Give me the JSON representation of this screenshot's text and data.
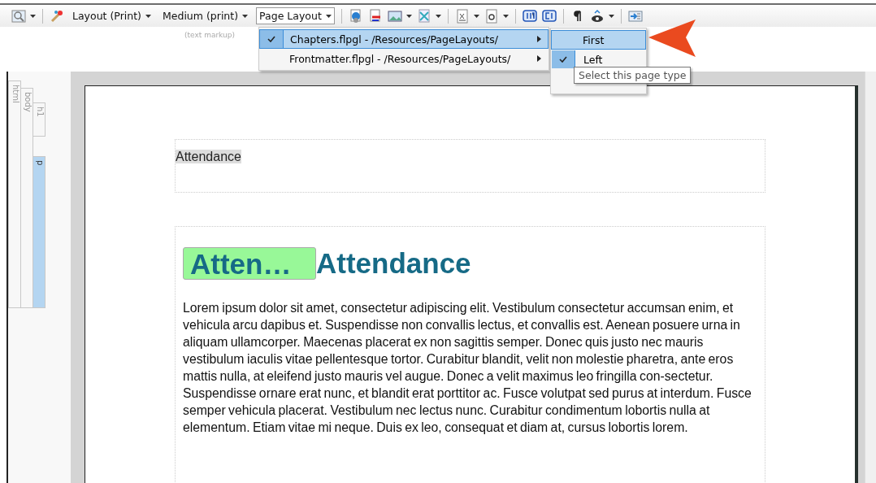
{
  "toolbar": {
    "dropdowns": [
      {
        "label": "Layout (Print)",
        "selected": false
      },
      {
        "label": "Medium (print)",
        "selected": false
      },
      {
        "label": "Page Layout",
        "selected": true
      }
    ]
  },
  "markup_label": "(text markup)",
  "menu": {
    "items": [
      {
        "label": "Chapters.flpgl - /Resources/PageLayouts/",
        "checked": true,
        "selected": true
      },
      {
        "label": "Frontmatter.flpgl - /Resources/PageLayouts/",
        "checked": false,
        "selected": false
      }
    ]
  },
  "submenu": {
    "items": [
      {
        "label": "First",
        "checked": false,
        "selected": true
      },
      {
        "label": "Left",
        "checked": true,
        "selected": false
      }
    ]
  },
  "tooltip": "Select this page type",
  "structure_tags": [
    {
      "label": "html",
      "selected": false
    },
    {
      "label": "body",
      "selected": false
    },
    {
      "label": "h1",
      "selected": false
    },
    {
      "label": "p",
      "selected": true
    }
  ],
  "page": {
    "header_text": "Attendance",
    "heading_badge": "Atten…",
    "heading": "Attendance",
    "paragraph": "Lorem ipsum dolor sit amet, consectetur adipiscing elit. Vestibulum consectetur accumsan enim, et vehicula arcu dapibus et. Suspendisse non convallis lectus, et convallis est. Aenean posuere urna in aliquam ullamcorper. Maecenas placerat ex non sagittis semper. Donec quis justo nec mauris vestibulum iaculis vitae pellentesque tortor. Curabitur blandit, velit non molestie pharetra, ante eros mattis nulla, at eleifend justo mauris vel augue. Donec a velit maximus leo fringilla con-sectetur. Suspendisse ornare erat nunc, et blandit erat porttitor ac. Fusce volutpat sed purus at interdum. Fusce semper vehicula placerat. Vestibulum nec lectus nunc. Curabitur condimentum lobortis nulla at elementum. Etiam vitae mi neque. Duis ex leo, consequat et diam at, cursus lobortis lorem."
  }
}
